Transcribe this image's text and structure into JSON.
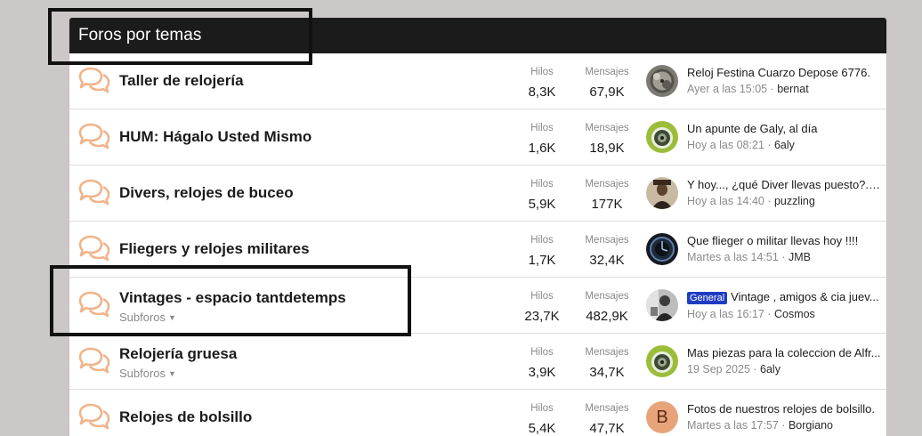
{
  "section_title": "Foros por temas",
  "labels": {
    "threads": "Hilos",
    "messages": "Mensajes",
    "subforums": "Subforos"
  },
  "forums": [
    {
      "title": "Taller de relojería",
      "threads": "8,3K",
      "messages": "67,9K",
      "latest_title": "Reloj Festina Cuarzo Depose 6776.",
      "latest_time": "Ayer a las 15:05",
      "latest_user": "bernat",
      "avatar": "gears",
      "has_subforums": false,
      "prefix": ""
    },
    {
      "title": "HUM: Hágalo Usted Mismo",
      "threads": "1,6K",
      "messages": "18,9K",
      "latest_title": "Un apunte de Galy, al día",
      "latest_time": "Hoy a las 08:21",
      "latest_user": "6aly",
      "avatar": "green-dial",
      "has_subforums": false,
      "prefix": ""
    },
    {
      "title": "Divers, relojes de buceo",
      "threads": "5,9K",
      "messages": "177K",
      "latest_title": "Y hoy..., ¿qué Diver llevas puesto?. (...",
      "latest_time": "Hoy a las 14:40",
      "latest_user": "puzzling",
      "avatar": "portrait",
      "has_subforums": false,
      "prefix": ""
    },
    {
      "title": "Fliegers y relojes militares",
      "threads": "1,7K",
      "messages": "32,4K",
      "latest_title": "Que flieger o militar llevas hoy !!!!",
      "latest_time": "Martes a las 14:51",
      "latest_user": "JMB",
      "avatar": "dark-dial",
      "has_subforums": false,
      "prefix": ""
    },
    {
      "title": "Vintages - espacio tantdetemps",
      "threads": "23,7K",
      "messages": "482,9K",
      "latest_title": "Vintage , amigos & cia juev...",
      "latest_time": "Hoy a las 16:17",
      "latest_user": "Cosmos",
      "avatar": "bw-photo",
      "has_subforums": true,
      "prefix": "General"
    },
    {
      "title": "Relojería gruesa",
      "threads": "3,9K",
      "messages": "34,7K",
      "latest_title": "Mas piezas para la coleccion de Alfr...",
      "latest_time": "19 Sep 2025",
      "latest_user": "6aly",
      "avatar": "green-dial",
      "has_subforums": true,
      "prefix": ""
    },
    {
      "title": "Relojes de bolsillo",
      "threads": "5,4K",
      "messages": "47,7K",
      "latest_title": "Fotos de nuestros relojes de bolsillo.",
      "latest_time": "Martes a las 17:57",
      "latest_user": "Borgiano",
      "avatar": "letter-b",
      "avatar_letter": "B",
      "has_subforums": false,
      "prefix": ""
    }
  ],
  "colors": {
    "header_bg": "#1b1b1b",
    "icon": "#f0b48a",
    "prefix_badge": "#1f3cc4",
    "avatar_letter_bg": "#e7a47a"
  }
}
